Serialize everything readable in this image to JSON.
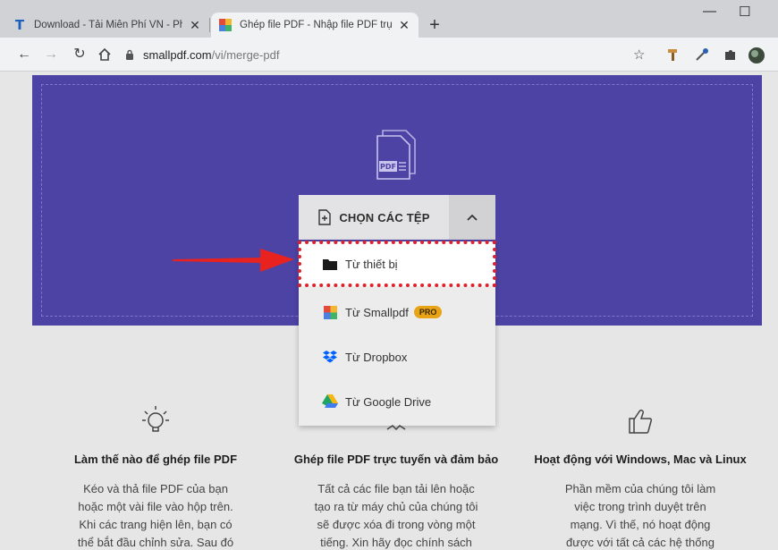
{
  "browser": {
    "tabs": [
      {
        "title": "Download - Tải Miễn Phí VN - Ph",
        "active": false
      },
      {
        "title": "Ghép file PDF - Nhập file PDF trự",
        "active": true
      }
    ],
    "new_tab": "+",
    "url": {
      "host": "smallpdf.com",
      "path": "/vi/merge-pdf"
    }
  },
  "uploader": {
    "choose_label": "CHỌN CÁC TỆP",
    "menu": [
      {
        "label": "Từ thiết bị",
        "badge": ""
      },
      {
        "label": "Từ Smallpdf",
        "badge": "PRO"
      },
      {
        "label": "Từ Dropbox",
        "badge": ""
      },
      {
        "label": "Từ Google Drive",
        "badge": ""
      }
    ]
  },
  "features": [
    {
      "title": "Làm thế nào để ghép file PDF",
      "lines": [
        "Kéo và thả file PDF của bạn",
        "hoặc một vài file vào hộp trên.",
        "Khi các trang hiện lên, bạn có",
        "thể bắt đầu chỉnh sửa. Sau đó"
      ]
    },
    {
      "title": "Ghép file PDF trực tuyến và đảm bảo",
      "lines": [
        "Tất cả các file bạn tải lên hoặc",
        "tạo ra từ máy chủ của chúng tôi",
        "sẽ được xóa đi trong vòng một",
        "tiếng. Xin hãy đọc chính sách"
      ]
    },
    {
      "title": "Hoạt động với Windows, Mac và Linux",
      "lines": [
        "Phần mềm của chúng tôi làm",
        "việc trong trình duyệt trên",
        "mạng. Vì thế, nó hoạt động",
        "được với tất cả các hệ thống"
      ]
    }
  ],
  "colors": {
    "hero": "#4d43a5",
    "highlight_border": "#e0202a",
    "arrow": "#e8231f",
    "pro_badge": "#e8a317"
  }
}
